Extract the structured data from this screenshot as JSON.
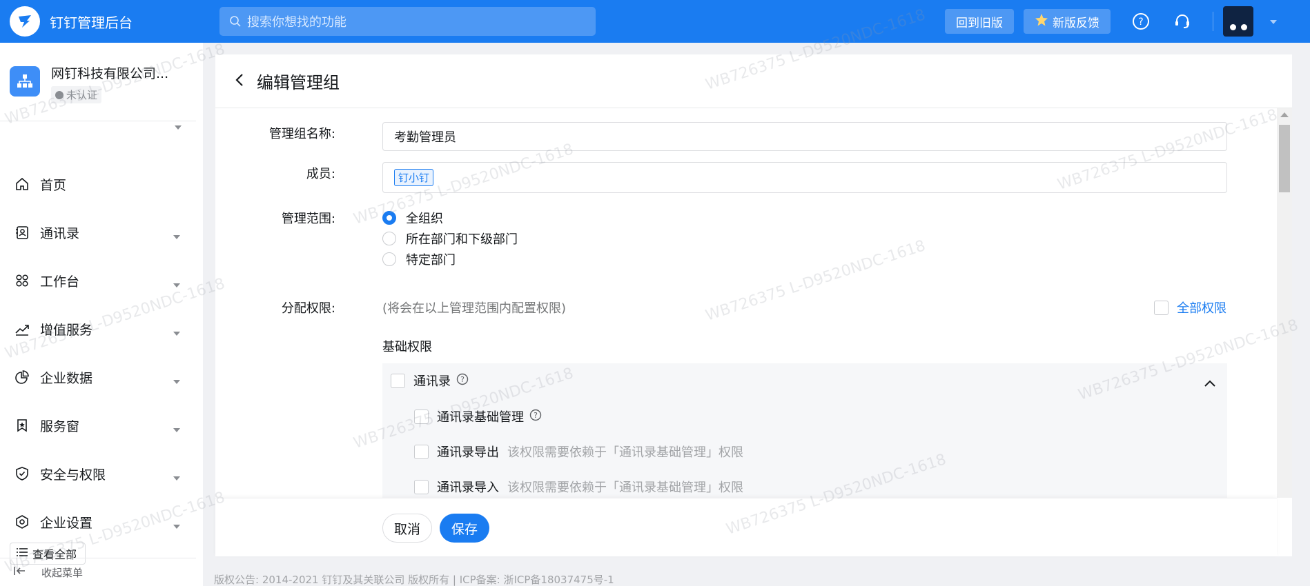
{
  "topbar": {
    "app_title": "钉钉管理后台",
    "search_placeholder": "搜索你想找的功能",
    "back_to_old_label": "回到旧版",
    "feedback_label": "新版反馈"
  },
  "sidebar": {
    "org_name": "网钉科技有限公司...",
    "org_status": "未认证",
    "items": [
      {
        "label": "首页",
        "icon": "home-icon"
      },
      {
        "label": "通讯录",
        "icon": "contacts-icon"
      },
      {
        "label": "工作台",
        "icon": "workbench-icon"
      },
      {
        "label": "增值服务",
        "icon": "trend-icon"
      },
      {
        "label": "企业数据",
        "icon": "pie-chart-icon"
      },
      {
        "label": "服务窗",
        "icon": "bookmark-icon"
      },
      {
        "label": "安全与权限",
        "icon": "shield-icon"
      },
      {
        "label": "企业设置",
        "icon": "settings-icon"
      }
    ],
    "view_all_label": "查看全部",
    "collapse_label": "收起菜单"
  },
  "page": {
    "title": "编辑管理组",
    "form": {
      "group_name_label": "管理组名称:",
      "group_name_value": "考勤管理员",
      "members_label": "成员:",
      "member_tag": "钉小钉",
      "scope_label": "管理范围:",
      "scope_options": [
        "全组织",
        "所在部门和下级部门",
        "特定部门"
      ],
      "scope_selected": "全组织",
      "permissions_label": "分配权限:",
      "permissions_hint": "(将会在以上管理范围内配置权限)",
      "all_permissions_label": "全部权限",
      "basic_section_title": "基础权限",
      "permissions": [
        {
          "label": "通讯录",
          "note": ""
        },
        {
          "label": "通讯录基础管理",
          "note": ""
        },
        {
          "label": "通讯录导出",
          "note": "该权限需要依赖于「通讯录基础管理」权限"
        },
        {
          "label": "通讯录导入",
          "note": "该权限需要依赖于「通讯录基础管理」权限"
        }
      ]
    },
    "cancel_label": "取消",
    "save_label": "保存"
  },
  "footer": {
    "copyright": "版权公告: 2014-2021 钉钉及其关联公司 版权所有 | ICP备案: 浙ICP备18037475号-1"
  },
  "watermark_text": "WB726375 L-D9520NDC-1618",
  "colors": {
    "accent": "#1a7cf1",
    "topbar": "#1a7cf1",
    "background": "#f0f1f4"
  }
}
